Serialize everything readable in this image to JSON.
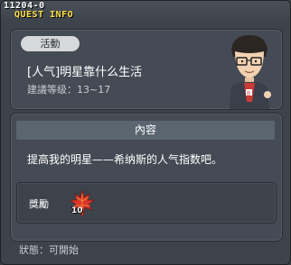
{
  "window": {
    "quest_id": "11204-0",
    "title": "QUEST INFO"
  },
  "quest": {
    "tag": "活動",
    "name": "[人气]明星靠什么生活",
    "level": "建議等级：13~17"
  },
  "content": {
    "header": "內容",
    "description": "提高我的明星——希纳斯的人气指数吧。"
  },
  "reward": {
    "label": "獎勵",
    "item_icon": "maple-leaf-icon",
    "item_count": "10"
  },
  "status": "狀態：可開始",
  "colors": {
    "title": "#ffe14a",
    "background": "#3d434b",
    "panel": "#454b54",
    "header_bar": "#5a6570"
  }
}
